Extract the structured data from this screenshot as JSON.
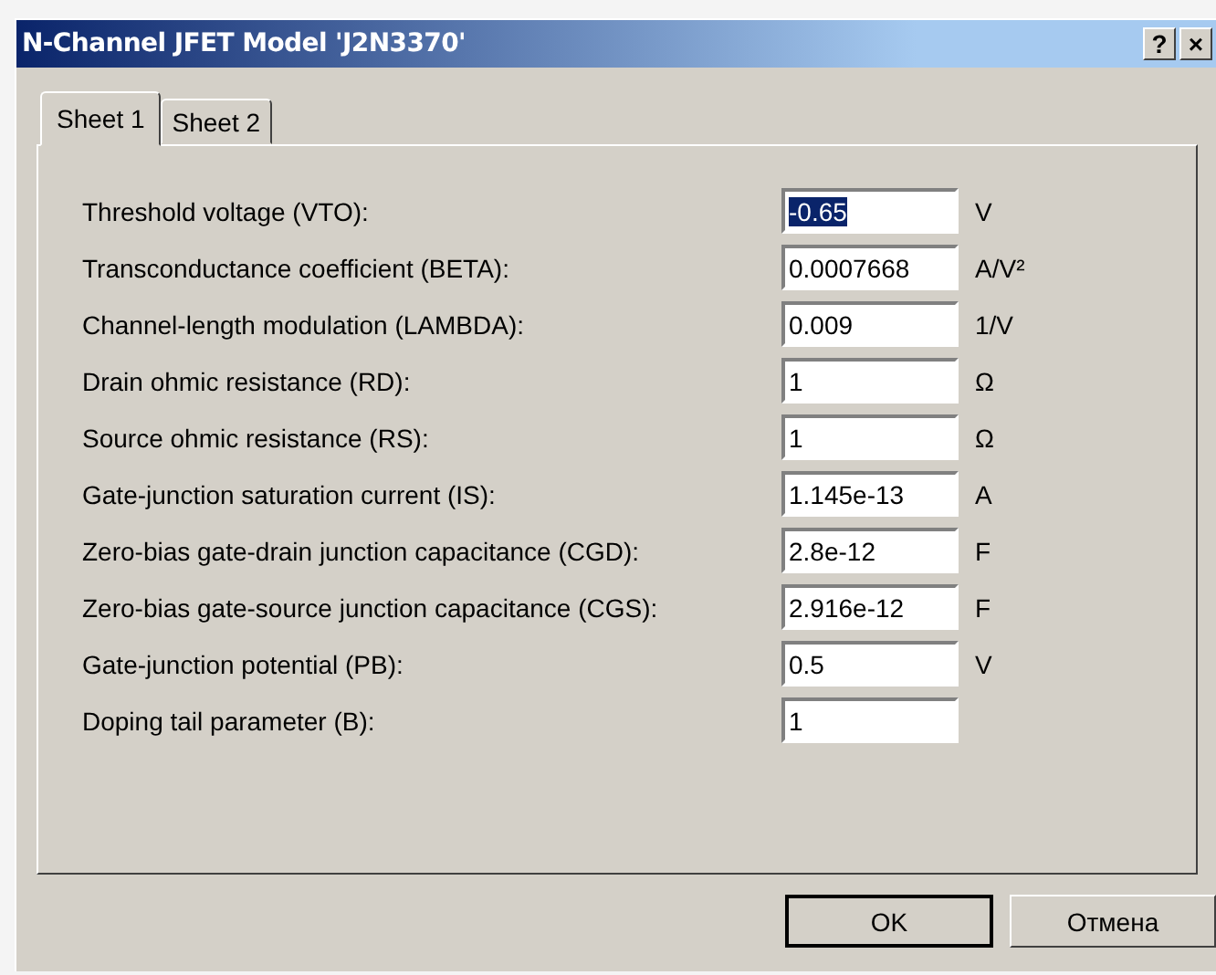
{
  "window": {
    "title": "N-Channel JFET Model 'J2N3370'",
    "buttons": [
      {
        "kind": "help",
        "label": "?"
      },
      {
        "kind": "close",
        "label": "×"
      }
    ]
  },
  "tabs": [
    {
      "label": "Sheet 1",
      "selected": true
    },
    {
      "label": "Sheet 2",
      "selected": false
    }
  ],
  "parameters": [
    {
      "label": "Threshold voltage (VTO):",
      "value": "-0.65",
      "unit": "V",
      "highlighted": true
    },
    {
      "label": "Transconductance coefficient (BETA):",
      "value": "0.0007668",
      "unit": "A/V²",
      "highlighted": false
    },
    {
      "label": "Channel-length modulation (LAMBDA):",
      "value": "0.009",
      "unit": "1/V",
      "highlighted": false
    },
    {
      "label": "Drain ohmic resistance (RD):",
      "value": "1",
      "unit": "Ω",
      "highlighted": false
    },
    {
      "label": "Source ohmic resistance (RS):",
      "value": "1",
      "unit": "Ω",
      "highlighted": false
    },
    {
      "label": "Gate-junction saturation current (IS):",
      "value": "1.145e-13",
      "unit": "A",
      "highlighted": false
    },
    {
      "label": "Zero-bias gate-drain junction capacitance (CGD):",
      "value": "2.8e-12",
      "unit": "F",
      "highlighted": false
    },
    {
      "label": "Zero-bias gate-source junction capacitance (CGS):",
      "value": "2.916e-12",
      "unit": "F",
      "highlighted": false
    },
    {
      "label": "Gate-junction potential (PB):",
      "value": "0.5",
      "unit": "V",
      "highlighted": false
    },
    {
      "label": "Doping tail parameter (B):",
      "value": "1",
      "highlighted": false
    }
  ],
  "buttons": [
    {
      "label": "OK",
      "default": true
    },
    {
      "label": "Отмена",
      "default": false
    }
  ]
}
